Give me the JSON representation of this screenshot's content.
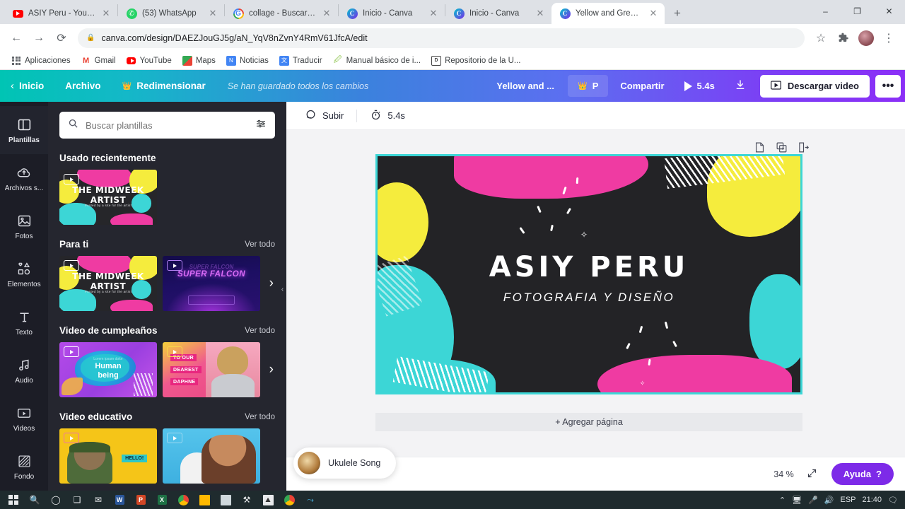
{
  "browser": {
    "tabs": [
      {
        "title": "ASIY Peru - YouTube",
        "icon": "youtube-icon",
        "active": false
      },
      {
        "title": "(53) WhatsApp",
        "icon": "whatsapp-icon",
        "active": false
      },
      {
        "title": "collage - Buscar con Go",
        "icon": "google-icon",
        "active": false
      },
      {
        "title": "Inicio - Canva",
        "icon": "canva-icon",
        "active": false
      },
      {
        "title": "Inicio - Canva",
        "icon": "canva-icon",
        "active": false
      },
      {
        "title": "Yellow and Green Spark",
        "icon": "canva-icon",
        "active": true
      }
    ],
    "new_tab_label": "+",
    "window_controls": {
      "minimize": "–",
      "maximize": "❐",
      "close": "✕"
    },
    "nav": {
      "back": "←",
      "forward": "→",
      "reload": "⟳"
    },
    "address": {
      "url": "canva.com/design/DAEZJouGJ5g/aN_YqV8nZvnY4RmV61JfcA/edit",
      "lock_icon": "lock-icon"
    },
    "toolbar_right": {
      "star": "☆",
      "extensions": "extensions-icon",
      "menu": "⋮"
    },
    "bookmarks": [
      {
        "label": "Aplicaciones",
        "icon": "apps-grid-icon"
      },
      {
        "label": "Gmail",
        "icon": "gmail-icon"
      },
      {
        "label": "YouTube",
        "icon": "youtube-icon"
      },
      {
        "label": "Maps",
        "icon": "maps-icon"
      },
      {
        "label": "Noticias",
        "icon": "news-icon"
      },
      {
        "label": "Traducir",
        "icon": "translate-icon"
      },
      {
        "label": "Manual básico de i...",
        "icon": "doc-icon"
      },
      {
        "label": "Repositorio de la U...",
        "icon": "repo-icon"
      }
    ]
  },
  "canva": {
    "header": {
      "back_icon": "chevron-left-icon",
      "home": "Inicio",
      "file": "Archivo",
      "resize": "Redimensionar",
      "resize_icon": "crown-icon",
      "saved_status": "Se han guardado todos los cambios",
      "design_title": "Yellow and ...",
      "pro_badge": "P",
      "pro_badge_icon": "crown-icon",
      "share": "Compartir",
      "play_icon": "play-icon",
      "duration": "5.4s",
      "download_icon": "download-icon",
      "download_video": "Descargar video",
      "download_video_icon": "video-icon",
      "more": "•••"
    },
    "rail": [
      {
        "label": "Plantillas",
        "icon": "templates-icon",
        "selected": true
      },
      {
        "label": "Archivos s...",
        "icon": "cloud-upload-icon",
        "selected": false
      },
      {
        "label": "Fotos",
        "icon": "photos-icon",
        "selected": false
      },
      {
        "label": "Elementos",
        "icon": "elements-icon",
        "selected": false
      },
      {
        "label": "Texto",
        "icon": "text-icon",
        "selected": false
      },
      {
        "label": "Audio",
        "icon": "audio-icon",
        "selected": false
      },
      {
        "label": "Videos",
        "icon": "videos-icon",
        "selected": false
      },
      {
        "label": "Fondo",
        "icon": "background-icon",
        "selected": false
      }
    ],
    "panel": {
      "search_placeholder": "Buscar plantillas",
      "search_value": "",
      "search_icon": "search-icon",
      "filter_icon": "filters-icon",
      "collapse_icon": "chevron-left-icon",
      "sections": [
        {
          "title": "Usado recientemente",
          "see_all": "",
          "items": [
            {
              "name": "the-midweek-artist",
              "line1": "THE MIDWEEK",
              "line2": "ARTIST",
              "caption": "Posted by a site for the artist"
            }
          ]
        },
        {
          "title": "Para ti",
          "see_all": "Ver todo",
          "items": [
            {
              "name": "the-midweek-artist",
              "line1": "THE MIDWEEK",
              "line2": "ARTIST",
              "caption": "Posted by a site for the artist"
            },
            {
              "name": "super-falcon",
              "line1": "SUPER FALCON",
              "line2": "SUPER FALCON",
              "caption": ""
            }
          ]
        },
        {
          "title": "Video de cumpleaños",
          "see_all": "Ver todo",
          "items": [
            {
              "name": "human-being",
              "line1": "Human",
              "line2": "being",
              "caption": "Lorem ipsum dolor"
            },
            {
              "name": "to-our-dearest-daphne",
              "line1": "TO OUR",
              "line2": "DEAREST",
              "line3": "DAPHNE",
              "caption": ""
            }
          ]
        },
        {
          "title": "Video educativo",
          "see_all": "Ver todo",
          "items": [
            {
              "name": "hello-kid",
              "line1": "HELLO!",
              "caption": ""
            },
            {
              "name": "girl-blue",
              "line1": "",
              "caption": ""
            }
          ]
        }
      ]
    },
    "workspace": {
      "upload_label": "Subir",
      "upload_icon": "upload-icon",
      "timer_label": "5.4s",
      "timer_icon": "stopwatch-icon",
      "page_tools": [
        {
          "name": "notes-icon",
          "glyph": "notes"
        },
        {
          "name": "duplicate-page-icon",
          "glyph": "duplicate"
        },
        {
          "name": "export-page-icon",
          "glyph": "export"
        }
      ],
      "add_page": "+ Agregar página",
      "design": {
        "title": "ASIY PERU",
        "subtitle": "FOTOGRAFIA Y DISEÑO"
      },
      "audio_track": "Ukulele Song",
      "zoom": "34 %",
      "expand_icon": "expand-icon",
      "help": "Ayuda",
      "help_mark": "?"
    }
  },
  "taskbar": {
    "start_icon": "windows-icon",
    "items": [
      {
        "name": "search-icon",
        "glyph": "⌕"
      },
      {
        "name": "cortana-icon",
        "glyph": "◯"
      },
      {
        "name": "task-view-icon",
        "glyph": "☷"
      },
      {
        "name": "mail-icon",
        "glyph": "✉"
      },
      {
        "name": "word-icon",
        "glyph": "W"
      },
      {
        "name": "powerpoint-icon",
        "glyph": "P"
      },
      {
        "name": "excel-icon",
        "glyph": "X"
      },
      {
        "name": "chrome-icon",
        "glyph": "◉"
      },
      {
        "name": "explorer-icon",
        "glyph": "▱"
      },
      {
        "name": "store-icon",
        "glyph": "▢"
      },
      {
        "name": "tool-icon",
        "glyph": "⚒"
      },
      {
        "name": "photos-icon",
        "glyph": "⛰"
      },
      {
        "name": "chrome-active-icon",
        "glyph": "◉"
      },
      {
        "name": "app-icon",
        "glyph": "⤴"
      }
    ],
    "tray": {
      "chevron": "⌃",
      "network_icon": "network-icon",
      "mic_icon": "mic-icon",
      "volume_icon": "volume-icon",
      "language": "ESP",
      "time": "21:40",
      "notifications_icon": "notifications-icon"
    }
  },
  "colors": {
    "canva_purple": "#7d2ae8",
    "canva_teal": "#00c4b4",
    "design_pink": "#ef3ba2",
    "design_yellow": "#f5ec3d",
    "design_cyan": "#3cd6d6",
    "design_dark": "#232326"
  }
}
